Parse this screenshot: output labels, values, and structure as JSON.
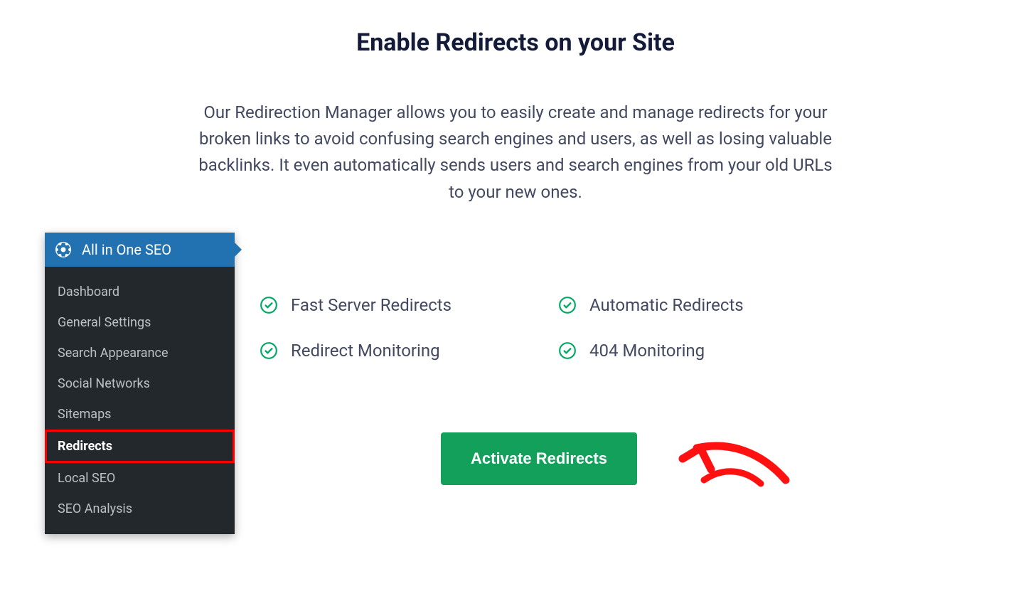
{
  "page": {
    "title": "Enable Redirects on your Site",
    "description": "Our Redirection Manager allows you to easily create and manage redirects for your broken links to avoid confusing search engines and users, as well as losing valuable backlinks. It even automatically sends users and search engines from your old URLs to your new ones."
  },
  "sidebar": {
    "header_label": "All in One SEO",
    "items": [
      {
        "label": "Dashboard",
        "active": false
      },
      {
        "label": "General Settings",
        "active": false
      },
      {
        "label": "Search Appearance",
        "active": false
      },
      {
        "label": "Social Networks",
        "active": false
      },
      {
        "label": "Sitemaps",
        "active": false
      },
      {
        "label": "Redirects",
        "active": true
      },
      {
        "label": "Local SEO",
        "active": false
      },
      {
        "label": "SEO Analysis",
        "active": false
      }
    ]
  },
  "features": [
    {
      "label": "Fast Server Redirects"
    },
    {
      "label": "Automatic Redirects"
    },
    {
      "label": "Redirect Monitoring"
    },
    {
      "label": "404 Monitoring"
    }
  ],
  "cta": {
    "activate_label": "Activate Redirects"
  },
  "colors": {
    "accent_blue": "#2271b1",
    "accent_green": "#13a05b",
    "check_green": "#00aa63",
    "highlight_red": "#ff0000",
    "text_dark": "#141b38",
    "text_body": "#434960",
    "sidebar_bg": "#23282d"
  }
}
